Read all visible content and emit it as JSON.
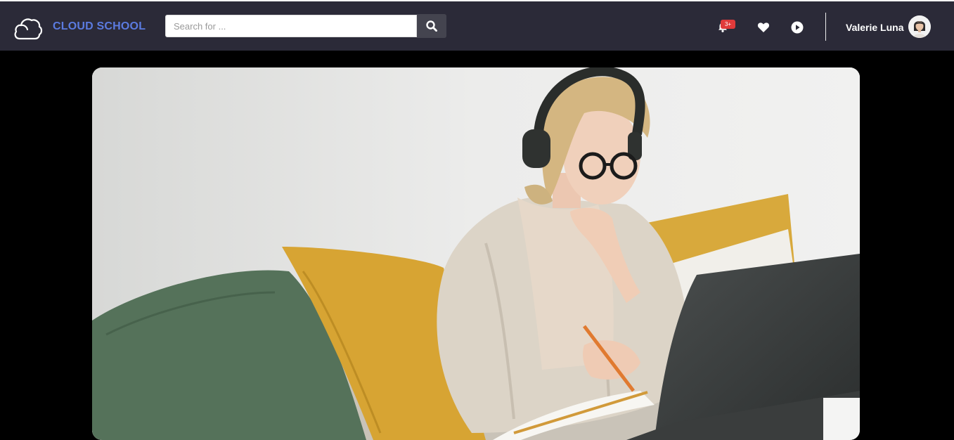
{
  "header": {
    "brand": "CLOUD SCHOOL",
    "search": {
      "placeholder": "Search for ..."
    },
    "notifications": {
      "badge": "3+"
    },
    "user": {
      "name": "Valerie Luna"
    }
  },
  "icons": {
    "logo": "cloud-outline-icon",
    "search": "search-icon",
    "notifications": "bell-icon",
    "wishlist": "heart-icon",
    "play": "play-circle-icon"
  },
  "colors": {
    "topbar": "#2b2a38",
    "brand": "#5b7be0",
    "badge": "#e03a3a",
    "background": "#000000"
  },
  "hero": {
    "image_subject": "woman with headphones and glasses studying on sofa with laptop"
  }
}
